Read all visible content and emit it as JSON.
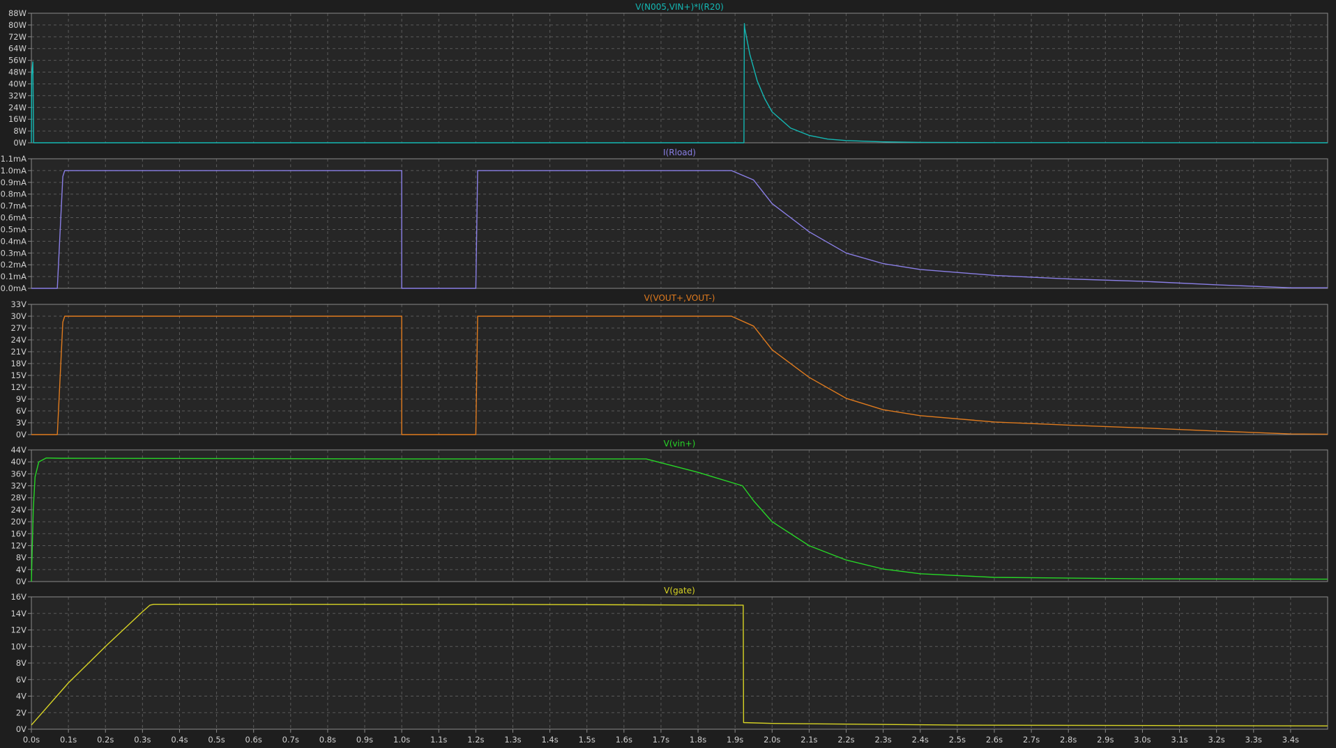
{
  "background": "#1e1e1e",
  "plot_background": "#262626",
  "grid_color": "#5a5a5a",
  "frame_color": "#8a8a8a",
  "chart_data": [
    {
      "type": "line",
      "title": "V(N005,VIN+)*I(R20)",
      "color": "#14b8b4",
      "grid": true,
      "xlim": [
        0,
        3.5
      ],
      "ylim": [
        0,
        88
      ],
      "yticks": [
        "0W",
        "8W",
        "16W",
        "24W",
        "32W",
        "40W",
        "48W",
        "56W",
        "64W",
        "72W",
        "80W",
        "88W"
      ],
      "series": [
        {
          "x": [
            0,
            0.001,
            0.004,
            0.006,
            0.01,
            1.924,
            1.925,
            1.926,
            1.94,
            1.96,
            1.98,
            2.0,
            2.05,
            2.1,
            2.15,
            2.2,
            2.3,
            2.4,
            2.6,
            3.5
          ],
          "y": [
            0,
            46,
            55,
            0,
            0,
            0,
            81,
            78,
            60,
            42,
            30,
            21,
            10,
            5,
            2.5,
            1.5,
            0.6,
            0.3,
            0.1,
            0
          ]
        }
      ]
    },
    {
      "type": "line",
      "title": "I(Rload)",
      "color": "#8a7fe6",
      "grid": true,
      "xlim": [
        0,
        3.5
      ],
      "ylim": [
        0,
        1.1
      ],
      "yticks": [
        "0.0mA",
        "0.1mA",
        "0.2mA",
        "0.3mA",
        "0.4mA",
        "0.5mA",
        "0.6mA",
        "0.7mA",
        "0.8mA",
        "0.9mA",
        "1.0mA",
        "1.1mA"
      ],
      "series": [
        {
          "x": [
            0,
            0.07,
            0.085,
            0.09,
            1.0,
            1.0,
            1.2,
            1.205,
            1.89,
            1.95,
            2.0,
            2.1,
            2.2,
            2.3,
            2.4,
            2.6,
            2.8,
            3.0,
            3.2,
            3.4,
            3.5
          ],
          "y": [
            0,
            0,
            0.95,
            1.0,
            1.0,
            0,
            0,
            1.0,
            1.0,
            0.92,
            0.72,
            0.48,
            0.3,
            0.21,
            0.16,
            0.11,
            0.08,
            0.06,
            0.03,
            0.005,
            0.005
          ]
        }
      ]
    },
    {
      "type": "line",
      "title": "V(VOUT+,VOUT-)",
      "color": "#e07b1e",
      "grid": true,
      "xlim": [
        0,
        3.5
      ],
      "ylim": [
        0,
        33
      ],
      "yticks": [
        "0V",
        "3V",
        "6V",
        "9V",
        "12V",
        "15V",
        "18V",
        "21V",
        "24V",
        "27V",
        "30V",
        "33V"
      ],
      "series": [
        {
          "x": [
            0,
            0.07,
            0.085,
            0.09,
            1.0,
            1.0,
            1.2,
            1.205,
            1.89,
            1.95,
            2.0,
            2.1,
            2.2,
            2.3,
            2.4,
            2.6,
            2.8,
            3.0,
            3.2,
            3.4,
            3.5
          ],
          "y": [
            0,
            0,
            28.5,
            30,
            30,
            0,
            0,
            30,
            30,
            27.5,
            21.5,
            14.5,
            9.2,
            6.3,
            4.8,
            3.2,
            2.4,
            1.7,
            0.9,
            0.15,
            0.1
          ]
        }
      ]
    },
    {
      "type": "line",
      "title": "V(vin+)",
      "color": "#27d627",
      "grid": true,
      "xlim": [
        0,
        3.5
      ],
      "ylim": [
        0,
        44
      ],
      "yticks": [
        "0V",
        "4V",
        "8V",
        "12V",
        "16V",
        "20V",
        "24V",
        "28V",
        "32V",
        "36V",
        "40V",
        "44V"
      ],
      "series": [
        {
          "x": [
            0,
            0.005,
            0.01,
            0.02,
            0.04,
            0.08,
            1.0,
            1.2,
            1.66,
            1.8,
            1.92,
            1.95,
            2.0,
            2.1,
            2.2,
            2.3,
            2.4,
            2.6,
            3.0,
            3.5
          ],
          "y": [
            0,
            24,
            35,
            40,
            41.3,
            41.2,
            41.0,
            41.0,
            41.0,
            36.5,
            32.0,
            27,
            20,
            12,
            7.2,
            4.2,
            2.6,
            1.4,
            0.9,
            0.8
          ]
        }
      ]
    },
    {
      "type": "line",
      "title": "V(gate)",
      "color": "#d8d424",
      "grid": true,
      "xlim": [
        0,
        3.5
      ],
      "ylim": [
        0,
        16
      ],
      "yticks": [
        "0V",
        "2V",
        "4V",
        "6V",
        "8V",
        "10V",
        "12V",
        "14V",
        "16V"
      ],
      "xticks": [
        "0.0s",
        "0.1s",
        "0.2s",
        "0.3s",
        "0.4s",
        "0.5s",
        "0.6s",
        "0.7s",
        "0.8s",
        "0.9s",
        "1.0s",
        "1.1s",
        "1.2s",
        "1.3s",
        "1.4s",
        "1.5s",
        "1.6s",
        "1.7s",
        "1.8s",
        "1.9s",
        "2.0s",
        "2.1s",
        "2.2s",
        "2.3s",
        "2.4s",
        "2.5s",
        "2.6s",
        "2.7s",
        "2.8s",
        "2.9s",
        "3.0s",
        "3.1s",
        "3.2s",
        "3.3s",
        "3.4s"
      ],
      "series": [
        {
          "x": [
            0,
            0.1,
            0.2,
            0.3,
            0.32,
            0.33,
            1.2,
            1.9,
            1.922,
            1.923,
            2.0,
            2.5,
            3.5
          ],
          "y": [
            0.5,
            5.6,
            10,
            14.2,
            15,
            15.1,
            15.1,
            15.0,
            15.0,
            0.8,
            0.7,
            0.5,
            0.4
          ]
        }
      ]
    }
  ]
}
